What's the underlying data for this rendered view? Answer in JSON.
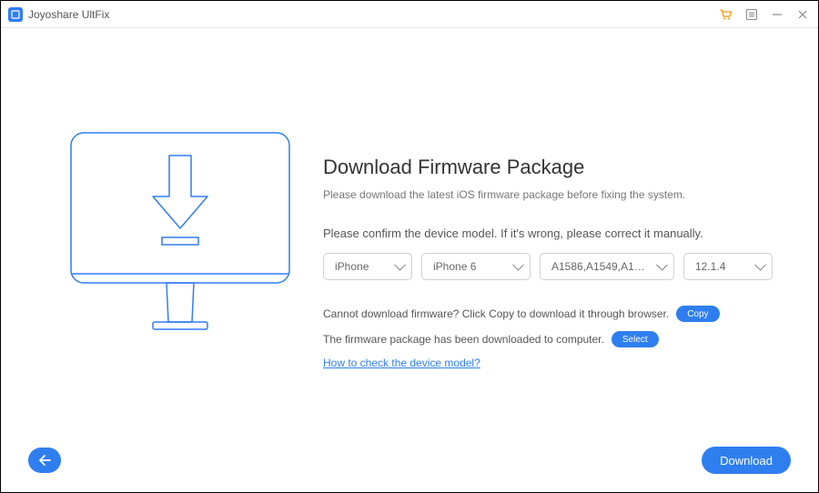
{
  "titlebar": {
    "app_name": "Joyoshare UltFix"
  },
  "main": {
    "heading": "Download Firmware Package",
    "subheading": "Please download the latest iOS firmware package before fixing the system.",
    "confirm_text": "Please confirm the device model. If it's wrong, please correct it manually.",
    "selects": {
      "device_type": "iPhone",
      "device_model": "iPhone 6",
      "model_numbers": "A1586,A1549,A1…",
      "ios_version": "12.1.4"
    },
    "copy_line": "Cannot download firmware? Click Copy to download it through browser.",
    "copy_btn": "Copy",
    "select_line": "The firmware package has been downloaded to computer.",
    "select_btn": "Select",
    "help_link": "How to check the device model?"
  },
  "footer": {
    "download_btn": "Download"
  }
}
